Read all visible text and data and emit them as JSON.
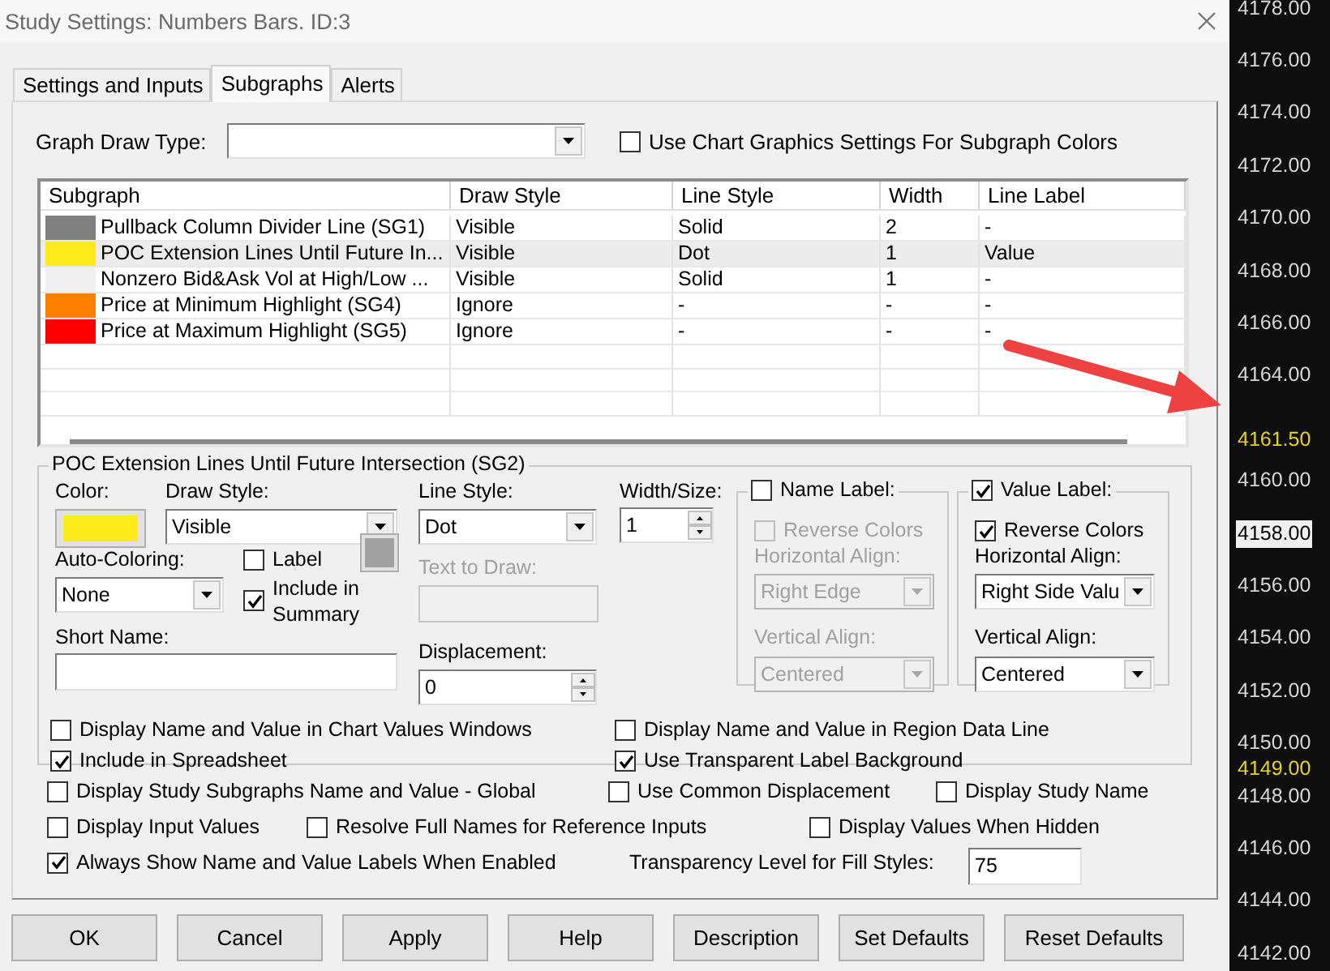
{
  "window": {
    "title": "Study Settings: Numbers Bars. ID:3"
  },
  "tabs": [
    {
      "label": "Settings and Inputs",
      "selected": false
    },
    {
      "label": "Subgraphs",
      "selected": true
    },
    {
      "label": "Alerts",
      "selected": false
    }
  ],
  "graph_draw_type": {
    "label": "Graph Draw Type:"
  },
  "use_chart_colors": {
    "label": "Use Chart Graphics Settings For Subgraph Colors",
    "checked": false
  },
  "table": {
    "columns": [
      "Subgraph",
      "Draw Style",
      "Line Style",
      "Width",
      "Line Label"
    ],
    "rows": [
      {
        "color": "#808080",
        "cells": [
          "Pullback Column Divider Line (SG1)",
          "Visible",
          "Solid",
          "2",
          "-"
        ],
        "selected": false
      },
      {
        "color": "#ffeb1c",
        "cells": [
          "POC Extension Lines Until Future In...",
          "Visible",
          "Dot",
          "1",
          "Value"
        ],
        "selected": true
      },
      {
        "color": "#f0f0f0",
        "cells": [
          "Nonzero Bid&Ask Vol at High/Low ...",
          "Visible",
          "Solid",
          "1",
          "-"
        ],
        "selected": false
      },
      {
        "color": "#ff8000",
        "cells": [
          "Price at Minimum Highlight (SG4)",
          "Ignore",
          "-",
          "-",
          "-"
        ],
        "selected": false
      },
      {
        "color": "#ff0000",
        "cells": [
          "Price at Maximum Highlight (SG5)",
          "Ignore",
          "-",
          "-",
          "-"
        ],
        "selected": false
      }
    ]
  },
  "detail": {
    "title": "POC Extension Lines Until Future Intersection (SG2)",
    "color_setting": {
      "label": "Color:",
      "color": "#ffeb1c"
    },
    "draw_style": {
      "label": "Draw Style:",
      "value": "Visible"
    },
    "line_style": {
      "label": "Line Style:",
      "value": "Dot"
    },
    "width": {
      "label": "Width/Size:",
      "value": "1"
    },
    "auto_coloring": {
      "label": "Auto-Coloring:",
      "value": "None"
    },
    "label_checkbox": {
      "label": "Label",
      "checked": false
    },
    "label_swatch": {
      "color": "#a0a0a0"
    },
    "include_in_summary": {
      "label": "Include in Summary",
      "checked": true
    },
    "text_to_draw": {
      "label": "Text to Draw:",
      "disabled": true
    },
    "short_name": {
      "label": "Short Name:"
    },
    "displacement": {
      "label": "Displacement:",
      "value": "0"
    },
    "name_label": {
      "label": "Name Label:",
      "checked": false,
      "reverse_colors": {
        "label": "Reverse Colors",
        "checked": false,
        "disabled": true
      },
      "horizontal_align": {
        "label": "Horizontal Align:",
        "value": "Right Edge",
        "disabled": true
      },
      "vertical_align": {
        "label": "Vertical Align:",
        "value": "Centered",
        "disabled": true
      }
    },
    "value_label": {
      "label": "Value Label:",
      "checked": true,
      "reverse_colors": {
        "label": "Reverse Colors",
        "checked": true,
        "disabled": false
      },
      "horizontal_align": {
        "label": "Horizontal Align:",
        "value": "Right Side Valu",
        "disabled": false
      },
      "vertical_align": {
        "label": "Vertical Align:",
        "value": "Centered",
        "disabled": false
      }
    },
    "options": [
      {
        "label": "Display Name and Value in Chart Values Windows",
        "checked": false
      },
      {
        "label": "Display Name and Value in Region Data Line",
        "checked": false
      },
      {
        "label": "Include in Spreadsheet",
        "checked": true
      },
      {
        "label": "Use Transparent Label Background",
        "checked": true
      }
    ]
  },
  "global_options": [
    [
      {
        "label": "Display Study Subgraphs Name and Value - Global",
        "checked": false
      },
      {
        "label": "Use Common Displacement",
        "checked": false
      },
      {
        "label": "Display Study Name",
        "checked": false
      }
    ],
    [
      {
        "label": "Display Input Values",
        "checked": false
      },
      {
        "label": "Resolve Full Names for Reference Inputs",
        "checked": false
      },
      {
        "label": "Display Values When Hidden",
        "checked": false
      }
    ],
    [
      {
        "label": "Always Show Name and Value Labels When Enabled",
        "checked": true
      }
    ]
  ],
  "transparency": {
    "label": "Transparency Level for Fill Styles:",
    "value": "75"
  },
  "buttons": [
    "OK",
    "Cancel",
    "Apply",
    "Help",
    "Description",
    "Set Defaults",
    "Reset Defaults"
  ],
  "price_axis": [
    {
      "kind": "tick",
      "label": "4178.00"
    },
    {
      "kind": "tick",
      "label": "4176.00"
    },
    {
      "kind": "tick",
      "label": "4174.00"
    },
    {
      "kind": "tick",
      "label": "4172.00"
    },
    {
      "kind": "tick",
      "label": "4170.00"
    },
    {
      "kind": "tick",
      "label": "4168.00"
    },
    {
      "kind": "tick",
      "label": "4166.00"
    },
    {
      "kind": "tick",
      "label": "4164.00"
    },
    {
      "kind": "current",
      "label": "4161.50"
    },
    {
      "kind": "tick",
      "label": "4160.00"
    },
    {
      "kind": "tick",
      "label": "4158.00",
      "highlighted": true
    },
    {
      "kind": "tick",
      "label": "4156.00"
    },
    {
      "kind": "tick",
      "label": "4154.00"
    },
    {
      "kind": "tick",
      "label": "4152.00"
    },
    {
      "kind": "tick",
      "label": "4150.00"
    },
    {
      "kind": "marker",
      "label": "4149.00"
    },
    {
      "kind": "tick",
      "label": "4148.00"
    },
    {
      "kind": "tick",
      "label": "4146.00"
    },
    {
      "kind": "tick",
      "label": "4144.00"
    },
    {
      "kind": "tick",
      "label": "4142.00"
    }
  ]
}
